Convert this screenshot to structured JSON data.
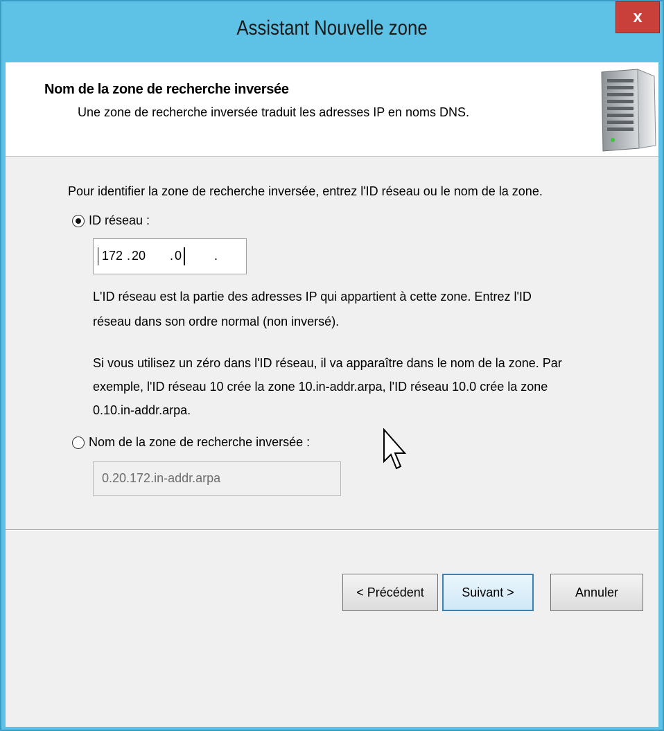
{
  "window": {
    "title": "Assistant Nouvelle zone",
    "close_label": "x"
  },
  "header": {
    "title": "Nom de la zone de recherche inversée",
    "subtitle": "Une zone de recherche inversée traduit les adresses IP en noms DNS.",
    "icon": "server-icon"
  },
  "content": {
    "intro": "Pour identifier la zone de recherche inversée, entrez l'ID réseau ou le nom de la zone.",
    "network_id_option": {
      "label": "ID réseau :",
      "selected": true,
      "octets": [
        "172",
        "20",
        "0",
        ""
      ],
      "separator": "."
    },
    "network_id_help_1_line1": "L'ID réseau est la partie des adresses IP qui appartient à cette zone. Entrez l'ID",
    "network_id_help_1_line2": "réseau dans son ordre normal (non inversé).",
    "network_id_help_2_line1": "Si vous utilisez un zéro dans l'ID réseau, il va apparaître dans le nom de la zone. Par",
    "network_id_help_2_line2": "exemple, l'ID réseau 10 crée la zone 10.in-addr.arpa, l'ID réseau 10.0 crée la zone",
    "network_id_help_2_line3": "0.10.in-addr.arpa.",
    "zone_name_option": {
      "label": "Nom de la zone de recherche inversée :",
      "selected": false,
      "value": "0.20.172.in-addr.arpa"
    }
  },
  "buttons": {
    "back": "< Précédent",
    "next": "Suivant >",
    "cancel": "Annuler"
  },
  "colors": {
    "title_bar": "#5ec1e6",
    "close_button": "#c9403a",
    "dialog_background": "#f0f0f0",
    "focus_border": "#3c7fb1"
  }
}
